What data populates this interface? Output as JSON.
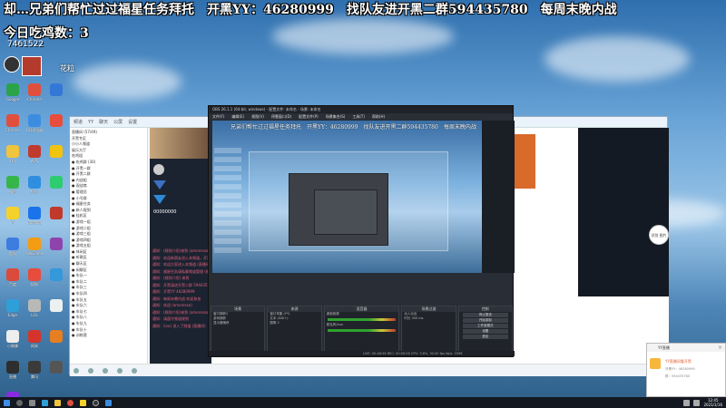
{
  "overlay": {
    "marquee": "却…兄弟们帮忙过过福星任务拜托　开黑YY：46280999　找队友进开黑二群594435780　每周末晚内战",
    "counter": "今日吃鸡数：3",
    "id_label": "7461522",
    "avatar_label": "花粒"
  },
  "desktop": {
    "icons_col1": [
      "Google",
      "Chrome",
      "QQ",
      "微信",
      "YY",
      "酷狗",
      "百度",
      "Edge",
      "小蜜蜂",
      "直播",
      "Pr",
      "DAD"
    ],
    "icons_col2": [
      "Chrome",
      "QQ浏览器",
      "WPS",
      "钉钉",
      "Cortana",
      "WeGame",
      "搜狗",
      "LOL",
      "网易",
      "腾讯"
    ]
  },
  "yy_window": {
    "title_items": [
      "频道",
      "YY",
      "聊天",
      "公屏",
      "设置"
    ],
    "tree_items": [
      "直播间 (57/49)",
      "开黑专区",
      "小小人频道",
      "娱乐大厅",
      "吃鸡组",
      "● 吃鸡群 (30)",
      "● 开黑一群",
      "● 开黑二群",
      "● 内战组",
      "● 观战席",
      "● 管理员",
      "● 小号群",
      "● 福星任务",
      "● 新人报到",
      "● 挂机区",
      "● 游戏一组",
      "● 游戏二组",
      "● 游戏三组",
      "● 游戏四组",
      "● 游戏五组",
      "● 休闲区",
      "● 听歌区",
      "● 聊天区",
      "● 闲聊区",
      "● 车队一",
      "● 车队二",
      "● 车队三",
      "● 车队四",
      "● 车队五",
      "● 车队六",
      "● 车队七",
      "● 车队八",
      "● 车队九",
      "● 车队十",
      "● 训练营"
    ],
    "chat_lines": [
      "通知：(规则介绍)来到 (amoresso)",
      "通知：欢迎新朋友进入本频道，开黑请加群",
      "通知：欢迎大家进入本频道 (直播间)",
      "通知：福星任务请私聊频道管理 (福星)",
      "通知：(规则介绍) 来到",
      "通知：开黑请进开黑二群 594435780",
      "通知：开黑YY 46280999",
      "通知：每周末晚内战 欢迎参加",
      "通知：欢迎 (amoresso)",
      "通知：(规则介绍)来到 (amoresso)",
      "通知：请遵守频道规则",
      "通知：(ivo) 进入了频道 (直播间)"
    ],
    "profile_label": "00000000",
    "float_badge": "识别\n图片",
    "orange_button": "开始直播"
  },
  "obs_window": {
    "title": "OBS 26.1.1 (64-bit, windows) - 配置文件: 未命名 - 场景: 未命名",
    "menu": [
      "文件(F)",
      "编辑(E)",
      "视图(V)",
      "停靠窗口(D)",
      "配置文件(P)",
      "场景集合(S)",
      "工具(T)",
      "帮助(H)"
    ],
    "preview_text": "兄弟们帮忙过过福星任务拜托　开黑YY：46280999　找队友进开黑二群594435780　每周末晚内战",
    "docks": {
      "scenes": {
        "title": "场景",
        "items": [
          "窗口捕获2",
          "游戏捕获",
          "显示器捕获"
        ]
      },
      "sources": {
        "title": "来源",
        "items": [
          "窗口采集 (YY)",
          "文本 (GDI+)",
          "图像 2"
        ]
      },
      "mixer": {
        "title": "混音器",
        "items": [
          "桌面音频",
          "麦克风/Aux"
        ]
      },
      "transitions": {
        "title": "场景过渡",
        "items": [
          "淡入淡出",
          "时长 300 ms"
        ]
      },
      "controls": {
        "title": "控制",
        "items": [
          "停止推流",
          "开始录制",
          "工作室模式",
          "设置",
          "退出"
        ]
      }
    },
    "status": "LIVE: 00:48:56   REC: 00:00:00   CPU: 3.8%, 30.00 fps   kb/s: 2596"
  },
  "popup": {
    "header": "YY直播",
    "title": "YY直播间看开黑",
    "line1": "开黑YY：46280999",
    "line2": "群：594435780"
  },
  "taskbar": {
    "clock_time": "12:45",
    "clock_date": "2021/1/16"
  }
}
